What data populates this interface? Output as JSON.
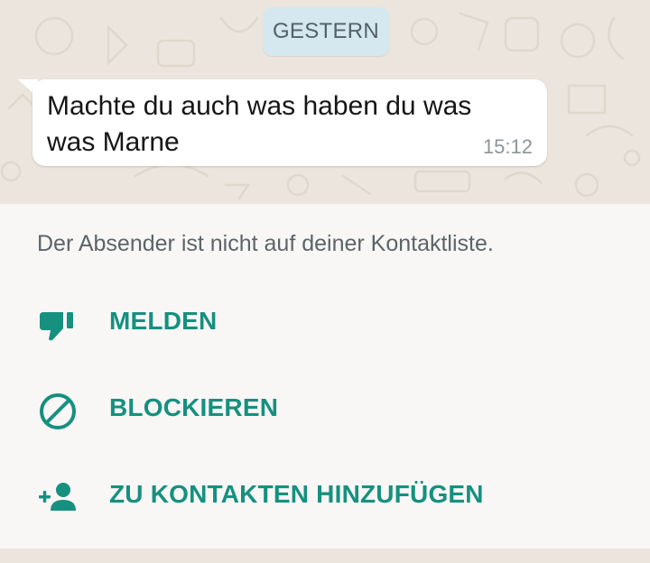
{
  "chat": {
    "date_chip": "GESTERN",
    "message": {
      "text": "Machte du auch was haben du was was Marne",
      "time": "15:12"
    }
  },
  "unknown_sender_panel": {
    "info_text": "Der Absender ist nicht auf deiner Kontaktliste.",
    "actions": [
      {
        "label": "MELDEN",
        "icon": "thumbs-down-icon"
      },
      {
        "label": "BLOCKIEREN",
        "icon": "block-icon"
      },
      {
        "label": "ZU KONTAKTEN HINZUFÜGEN",
        "icon": "add-contact-icon"
      }
    ]
  },
  "colors": {
    "accent": "#16907f",
    "chat_background": "#ece5dd",
    "date_chip_background": "#d5e8f0",
    "panel_background": "#f8f7f6"
  }
}
